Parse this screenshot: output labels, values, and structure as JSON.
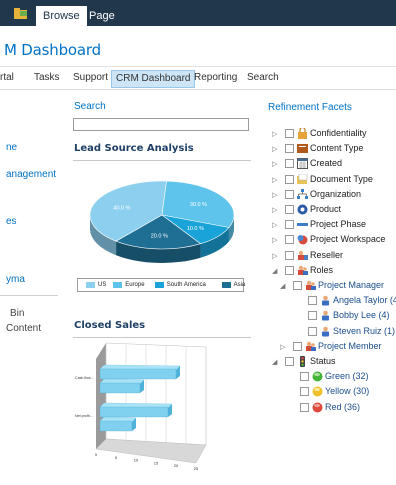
{
  "ribbon": {
    "tabs": [
      "Browse",
      "Page"
    ]
  },
  "title": "M Dashboard",
  "topnav": [
    "rtal",
    "Tasks",
    "Support",
    "CRM Dashboard",
    "Reporting",
    "Search"
  ],
  "leftnav": [
    "ne",
    "anagement",
    "es",
    "yma",
    "Bin",
    "Content"
  ],
  "search": {
    "heading": "Search",
    "value": ""
  },
  "lead": {
    "heading": "Lead Source Analysis",
    "chart_data": {
      "type": "pie",
      "categories": [
        "US",
        "Europe",
        "South America",
        "Asia"
      ],
      "values": [
        40.0,
        30.0,
        10.0,
        20.0
      ],
      "labels": [
        "40.0 %",
        "30.0 %",
        "10.0 %",
        "20.0 %"
      ],
      "colors": [
        "#8ccfef",
        "#5ec4ec",
        "#1aa3d8",
        "#1f6f95"
      ],
      "legend_position": "bottom"
    }
  },
  "closed": {
    "heading": "Closed Sales",
    "chart_data": {
      "type": "bar",
      "orientation": "horizontal",
      "categories": [
        "Cash flow...",
        "Net profit..."
      ],
      "series": [
        {
          "values": [
            19,
            17
          ]
        },
        {
          "values": [
            10,
            8
          ]
        }
      ],
      "xticks": [
        "0",
        "5",
        "10",
        "15",
        "20",
        "25"
      ],
      "xlim": [
        0,
        25
      ]
    }
  },
  "refinement": {
    "heading": "Refinement Facets",
    "items": [
      {
        "label": "Confidentiality",
        "level": 0,
        "arrow": "▷",
        "icon": "lock-icon"
      },
      {
        "label": "Content Type",
        "level": 0,
        "arrow": "▷",
        "icon": "content-type-icon"
      },
      {
        "label": "Created",
        "level": 0,
        "arrow": "▷",
        "icon": "calendar-icon"
      },
      {
        "label": "Document Type",
        "level": 0,
        "arrow": "▷",
        "icon": "document-type-icon"
      },
      {
        "label": "Organization",
        "level": 0,
        "arrow": "▷",
        "icon": "organization-icon"
      },
      {
        "label": "Product",
        "level": 0,
        "arrow": "▷",
        "icon": "product-icon"
      },
      {
        "label": "Project Phase",
        "level": 0,
        "arrow": "▷",
        "icon": "phase-icon"
      },
      {
        "label": "Project Workspace",
        "level": 0,
        "arrow": "▷",
        "icon": "workspace-icon"
      },
      {
        "label": "Reseller",
        "level": 0,
        "arrow": "▷",
        "icon": "reseller-icon"
      },
      {
        "label": "Roles",
        "level": 0,
        "arrow": "◢",
        "icon": "people-icon"
      },
      {
        "label": "Project Manager",
        "level": 1,
        "arrow": "◢",
        "icon": "people-icon",
        "link": true
      },
      {
        "label": "Angela Taylor (4)",
        "level": 2,
        "arrow": "",
        "icon": "person-icon",
        "link": true
      },
      {
        "label": "Bobby Lee (4)",
        "level": 2,
        "arrow": "",
        "icon": "person-icon",
        "link": true
      },
      {
        "label": "Steven Ruiz (1)",
        "level": 2,
        "arrow": "",
        "icon": "person-icon",
        "link": true
      },
      {
        "label": "Project Member",
        "level": 1,
        "arrow": "▷",
        "icon": "people-icon",
        "link": true
      },
      {
        "label": "Status",
        "level": 0,
        "arrow": "◢",
        "icon": "traffic-light-icon"
      },
      {
        "label": "Green (32)",
        "level": 1,
        "arrow": "",
        "icon": "green-status-icon",
        "link": true
      },
      {
        "label": "Yellow (30)",
        "level": 1,
        "arrow": "",
        "icon": "yellow-status-icon",
        "link": true
      },
      {
        "label": "Red (36)",
        "level": 1,
        "arrow": "",
        "icon": "red-status-icon",
        "link": true
      }
    ]
  },
  "colors": {
    "ribbon": "#21374c",
    "accent": "#0072c6",
    "heading": "#1f3f66"
  }
}
